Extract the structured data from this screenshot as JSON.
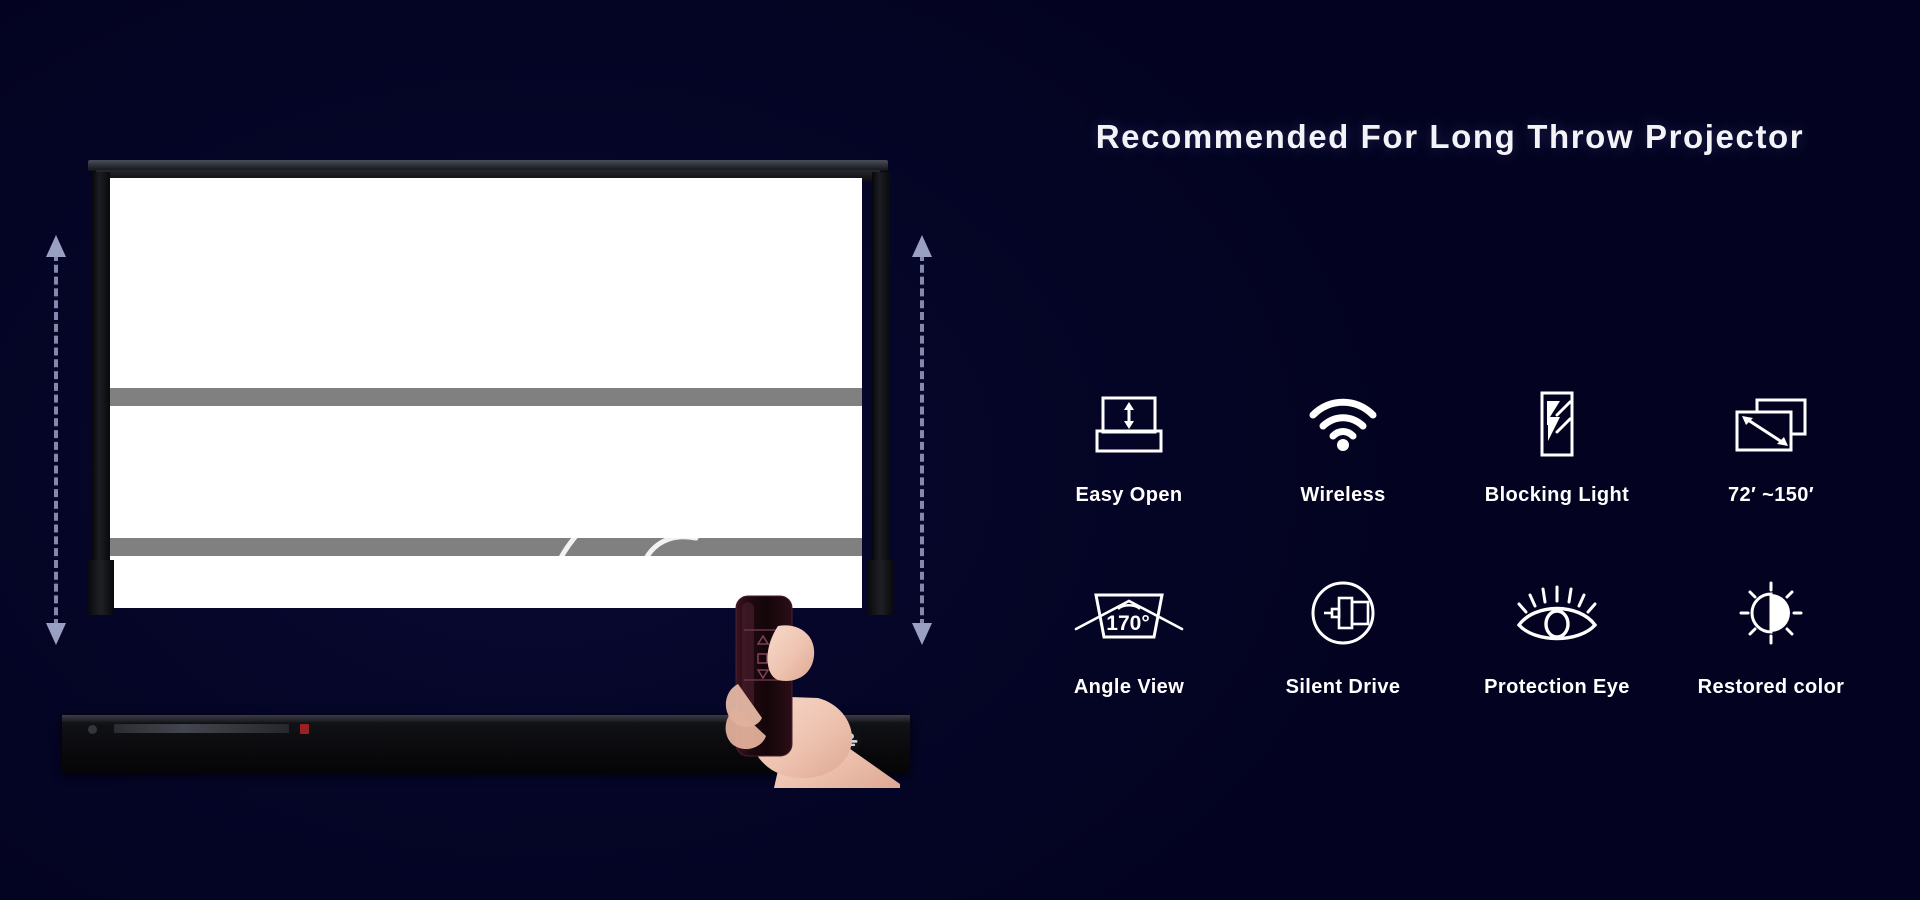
{
  "theme": {
    "background": "#030321",
    "accent": "#ffffff",
    "arrow_color": "#9aa0c4"
  },
  "headline": {
    "text": "Recommended For Long Throw Projector"
  },
  "product": {
    "name": "motorized-floor-rising-projector-screen",
    "height_arrow_left": "height-adjust-arrow-left",
    "height_arrow_right": "height-adjust-arrow-right",
    "remote": {
      "buttons": [
        "up",
        "stop",
        "down"
      ]
    }
  },
  "features": [
    {
      "icon": "screen-rise-icon",
      "label": "Easy Open"
    },
    {
      "icon": "wifi-icon",
      "label": "Wireless"
    },
    {
      "icon": "light-blocking-panel-icon",
      "label": "Blocking Light"
    },
    {
      "icon": "screen-size-diagonal-icon",
      "label": "72′  ~150′"
    },
    {
      "icon": "viewing-angle-170-icon",
      "label": "Angle View"
    },
    {
      "icon": "motor-in-circle-icon",
      "label": "Silent Drive"
    },
    {
      "icon": "eye-icon",
      "label": "Protection Eye"
    },
    {
      "icon": "brightness-contrast-icon",
      "label": "Restored color"
    }
  ],
  "icon_text": {
    "angle_value": "170°"
  }
}
